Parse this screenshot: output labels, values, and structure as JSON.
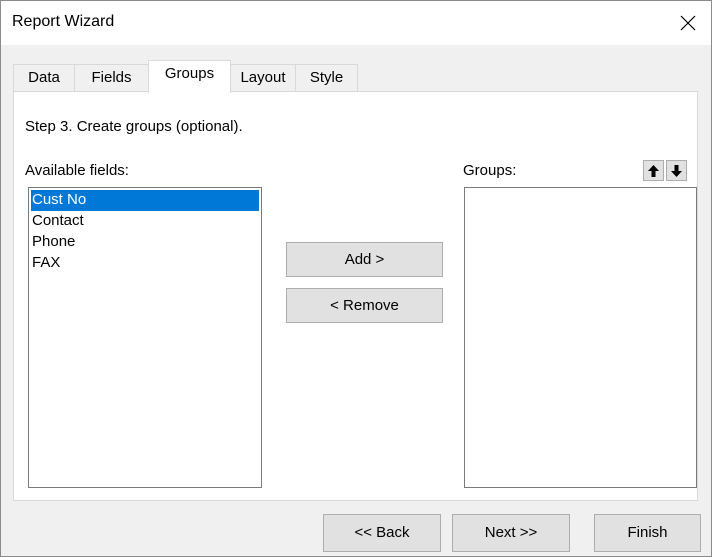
{
  "window": {
    "title": "Report Wizard"
  },
  "tabs": [
    {
      "label": "Data",
      "active": false
    },
    {
      "label": "Fields",
      "active": false
    },
    {
      "label": "Groups",
      "active": true
    },
    {
      "label": "Layout",
      "active": false
    },
    {
      "label": "Style",
      "active": false
    }
  ],
  "step": {
    "text": "Step 3. Create groups (optional)."
  },
  "available": {
    "label": "Available fields:",
    "items": [
      "Cust No",
      "Contact",
      "Phone",
      "FAX"
    ],
    "selected_index": 0
  },
  "groups": {
    "label": "Groups:",
    "items": []
  },
  "actions": {
    "add_label": "Add >",
    "remove_label": "< Remove"
  },
  "footer": {
    "back_label": "<< Back",
    "next_label": "Next >>",
    "finish_label": "Finish"
  },
  "icons": {
    "close": "close-icon",
    "move_up": "arrow-up-icon",
    "move_down": "arrow-down-icon"
  },
  "colors": {
    "selection": "#0078d7",
    "button_face": "#e1e1e1",
    "dialog_background": "#f0f0f0"
  }
}
